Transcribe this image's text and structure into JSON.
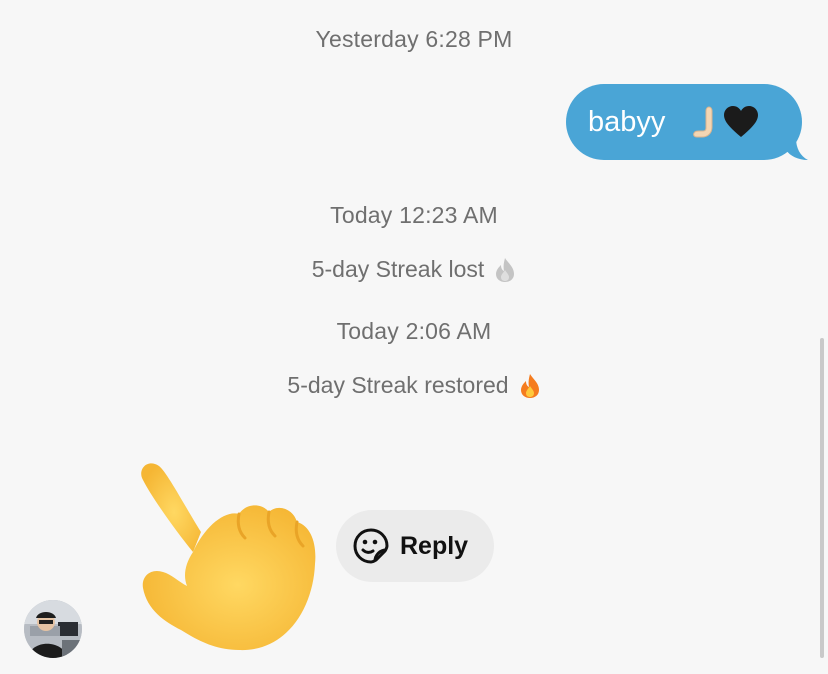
{
  "messages": {
    "timestamp_yesterday": "Yesterday 6:28 PM",
    "sent_bubble_text": "babyy",
    "timestamp_today_1": "Today 12:23 AM",
    "streak_lost": "5-day Streak lost",
    "timestamp_today_2": "Today 2:06 AM",
    "streak_restored": "5-day Streak restored"
  },
  "reply": {
    "label": "Reply"
  },
  "colors": {
    "bubble": "#4aa5d6",
    "background": "#f7f7f7",
    "system_text": "#6f6f6f",
    "reply_pill": "#ebebeb"
  },
  "icons": {
    "lost": "gray-flame-icon",
    "restored": "orange-flame-icon",
    "reply": "sticker-face-icon",
    "bubble": [
      "beckoning-hand-icon",
      "black-heart-icon"
    ],
    "overlay": "pointing-hand-icon"
  }
}
